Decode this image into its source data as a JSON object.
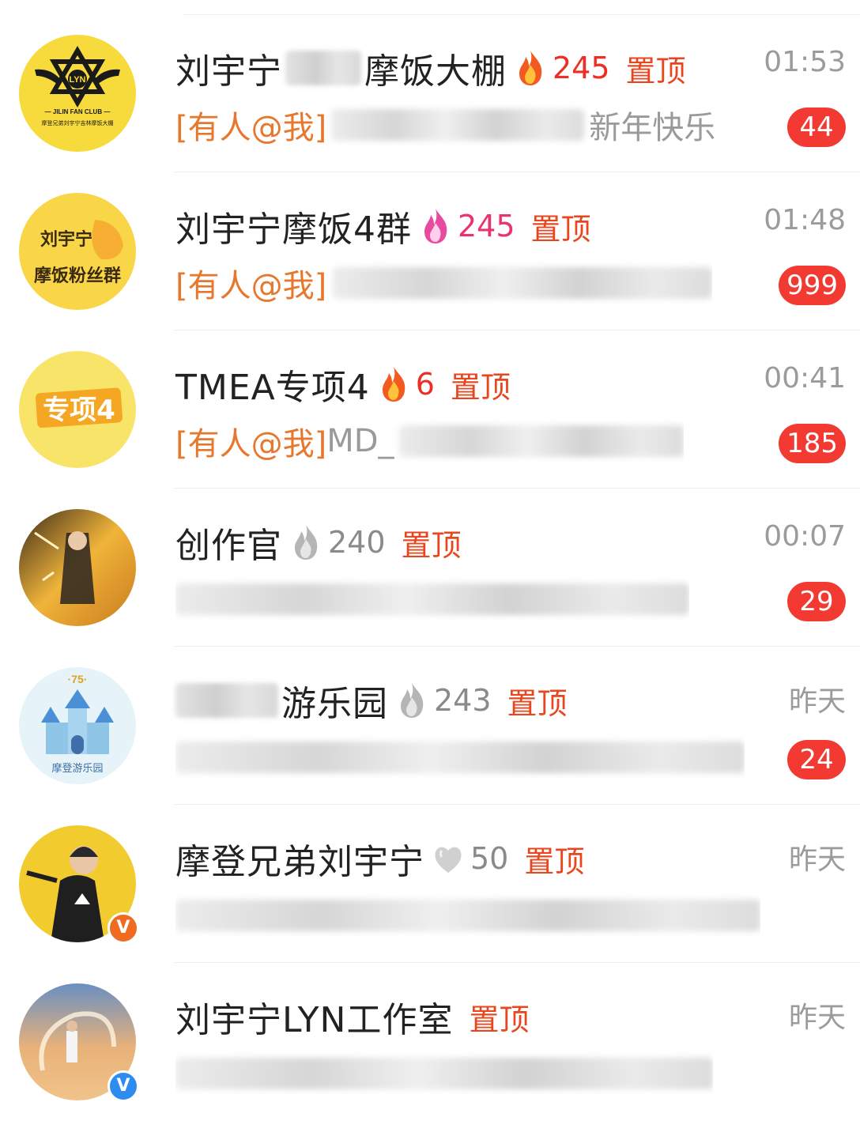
{
  "conversations": [
    {
      "name": "刘宇宁",
      "name_suffix": "摩饭大棚",
      "name_obscured": true,
      "fire_icon": "fire-red",
      "fire_count": "245",
      "pin_label": "置顶",
      "mention": "[有人@我]",
      "preview_tail": "新年快乐",
      "time": "01:53",
      "unread": "44",
      "avatar": {
        "label": "LYN",
        "sub1": "— JILIN FAN CLUB —",
        "sub2": "摩登兄弟刘宇宁吉林摩饭大棚",
        "bg": "#f7db3c"
      }
    },
    {
      "name": "刘宇宁摩饭4群",
      "fire_icon": "fire-pink",
      "fire_count": "245",
      "pin_label": "置顶",
      "mention": "[有人@我]",
      "time": "01:48",
      "unread": "999",
      "avatar": {
        "line1": "刘宇宁",
        "line2": "摩饭粉丝群",
        "bg": "#f9d648"
      }
    },
    {
      "name": "TMEA专项4",
      "fire_icon": "fire-red",
      "fire_count": "6",
      "pin_label": "置顶",
      "mention": "[有人@我]",
      "preview_start": "MD_",
      "time": "00:41",
      "unread": "185",
      "avatar": {
        "label": "专项4",
        "bg": "#f9e46a"
      }
    },
    {
      "name": "创作官",
      "fire_icon": "fire-gray",
      "fire_count": "240",
      "pin_label": "置顶",
      "time": "00:07",
      "unread": "29",
      "avatar": {
        "bg": "#f0b43a"
      }
    },
    {
      "name_suffix": "游乐园",
      "name_obscured": true,
      "fire_icon": "fire-gray",
      "fire_count": "243",
      "pin_label": "置顶",
      "time": "昨天",
      "unread": "24",
      "avatar": {
        "top": "·75·",
        "caption": "摩登游乐园",
        "bg": "#e6f4fa"
      }
    },
    {
      "name": "摩登兄弟刘宇宁",
      "fire_icon": "heart-gray",
      "fire_count": "50",
      "pin_label": "置顶",
      "time": "昨天",
      "verified": "V",
      "avatar": {
        "bg": "#f2cc2e"
      }
    },
    {
      "name": "刘宇宁LYN工作室",
      "pin_label": "置顶",
      "time": "昨天",
      "verified": "V",
      "avatar": {
        "bg": "#e8b27a"
      }
    }
  ],
  "colors": {
    "pin": "#e8461f",
    "mention": "#e8772e",
    "badge": "#f23a33",
    "fire_count_red": "#ee2e24",
    "fire_count_pink": "#e8336e"
  }
}
